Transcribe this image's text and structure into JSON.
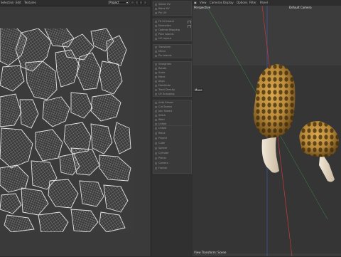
{
  "uv_editor": {
    "menu": [
      "Selection",
      "Edit",
      "Textures"
    ],
    "projection": "Project",
    "tool_buttons": [
      "uv-mode",
      "lock",
      "grid",
      "settings",
      "fit"
    ]
  },
  "tools": {
    "groups": [
      {
        "items": [
          "Select UV",
          "Relax UV",
          "Pin UV"
        ]
      },
      {
        "items": [
          "Fit UV Island",
          "Normalize",
          "Optimal Mapping",
          "Pack Islands",
          "UV Layout"
        ]
      },
      {
        "items": [
          "Transform",
          "Mirror",
          "Pin Islands"
        ]
      },
      {
        "items": [
          "Straighten",
          "Rotate",
          "Scale",
          "Move",
          "Align",
          "Distribute",
          "Texel Density",
          "UV Snapping"
        ]
      },
      {
        "items": [
          "Auto Seams",
          "Cut Seams",
          "Join Seams",
          "Stitch",
          "Weld",
          "Unfold",
          "Smooth",
          "Relax"
        ]
      },
      {
        "items": [
          "Unfold",
          "Relax",
          "Project",
          "Cube",
          "Sphere",
          "Cylinder",
          "Planar",
          "Camera",
          "Frontal"
        ]
      }
    ]
  },
  "viewport": {
    "menu": [
      "View",
      "Cameras",
      "Display",
      "Options",
      "Filter",
      "Panel"
    ],
    "perspective_label": "Perspective",
    "camera_label": "Default Camera",
    "move_label": "Move",
    "footer_label": "View Transform: Scene"
  },
  "colors": {
    "uv_background": "#3b3b3b",
    "uv_wire": "#d8d8d8",
    "morel_cap": "#b88a3a",
    "morel_stem": "#e8dcc8",
    "axis_red": "#c83a3a",
    "axis_green": "#3ab050",
    "axis_blue": "#4060c0"
  }
}
